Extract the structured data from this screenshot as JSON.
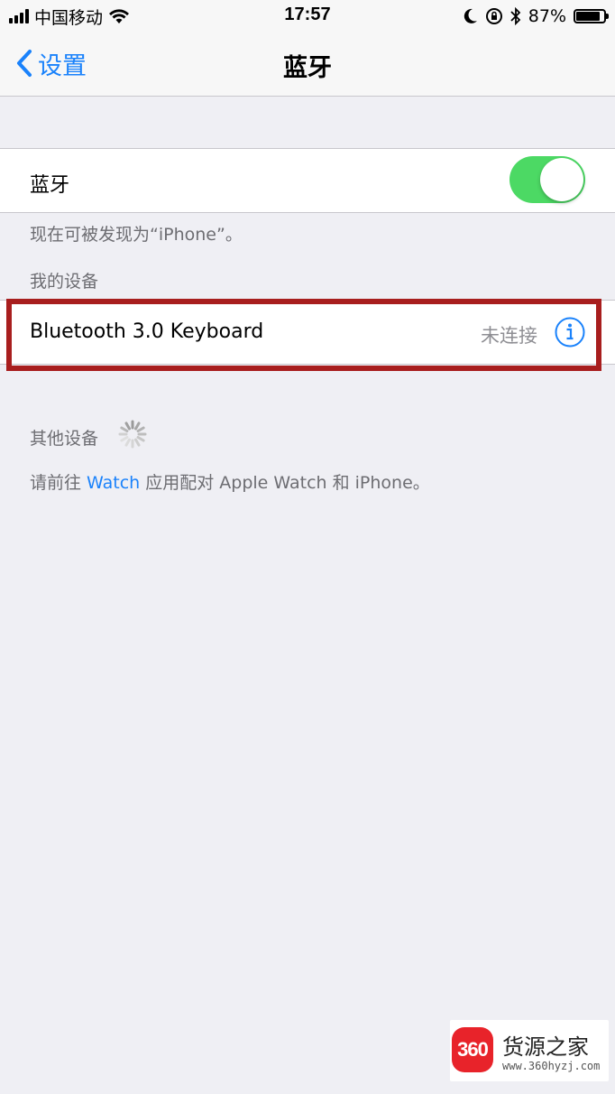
{
  "status_bar": {
    "carrier": "中国移动",
    "time": "17:57",
    "battery_percent": "87%",
    "battery_level": 0.87,
    "icons": [
      "signal-icon",
      "wifi-icon",
      "moon-icon",
      "rotation-lock-icon",
      "bluetooth-icon",
      "battery-icon"
    ]
  },
  "nav": {
    "back_label": "设置",
    "title": "蓝牙"
  },
  "bluetooth": {
    "label": "蓝牙",
    "enabled": true,
    "toggle_color": "#4cd964",
    "discoverable_note": "现在可被发现为“iPhone”。"
  },
  "my_devices": {
    "header": "我的设备",
    "items": [
      {
        "name": "Bluetooth 3.0 Keyboard",
        "status": "未连接",
        "info_icon": "info-icon"
      }
    ],
    "highlight_color": "#a81e1e"
  },
  "other_devices": {
    "header": "其他设备",
    "spinner_icon": "loading-spinner-icon"
  },
  "watch_note": {
    "before": "请前往 ",
    "link": "Watch",
    "after": " 应用配对 Apple Watch 和 iPhone。"
  },
  "watermark": {
    "logo_text": "360",
    "name": "货源之家",
    "url": "www.360hyzj.com"
  },
  "colors": {
    "accent": "#1a82fb",
    "background": "#efeff4",
    "secondary_text": "#6d6d72"
  }
}
